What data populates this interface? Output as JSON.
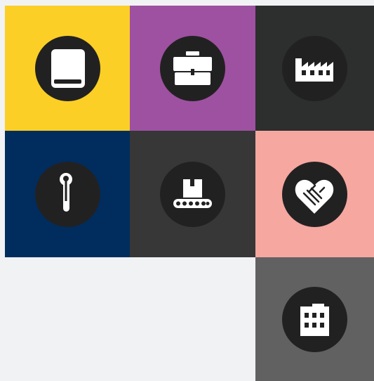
{
  "tiles": [
    {
      "id": "book",
      "icon": "book-icon",
      "label": "",
      "color": "#fccf26"
    },
    {
      "id": "briefcase",
      "icon": "briefcase-icon",
      "label": "",
      "color": "#9e51a0"
    },
    {
      "id": "factory",
      "icon": "factory-icon",
      "label": "",
      "color": "#2d2e2e"
    },
    {
      "id": "wrench",
      "icon": "wrench-icon",
      "label": "",
      "color": "#002d5e"
    },
    {
      "id": "conveyor",
      "icon": "conveyor-box-icon",
      "label": "",
      "color": "#363736"
    },
    {
      "id": "handshake",
      "icon": "heart-handshake-icon",
      "label": "",
      "color": "#f6a7a0"
    },
    {
      "id": "building",
      "icon": "office-building-icon",
      "label": "",
      "color": "#616161"
    }
  ],
  "colors": {
    "page_background": "#f1f2f4",
    "icon_circle": "#222122",
    "icon_glyph": "#ffffff"
  }
}
